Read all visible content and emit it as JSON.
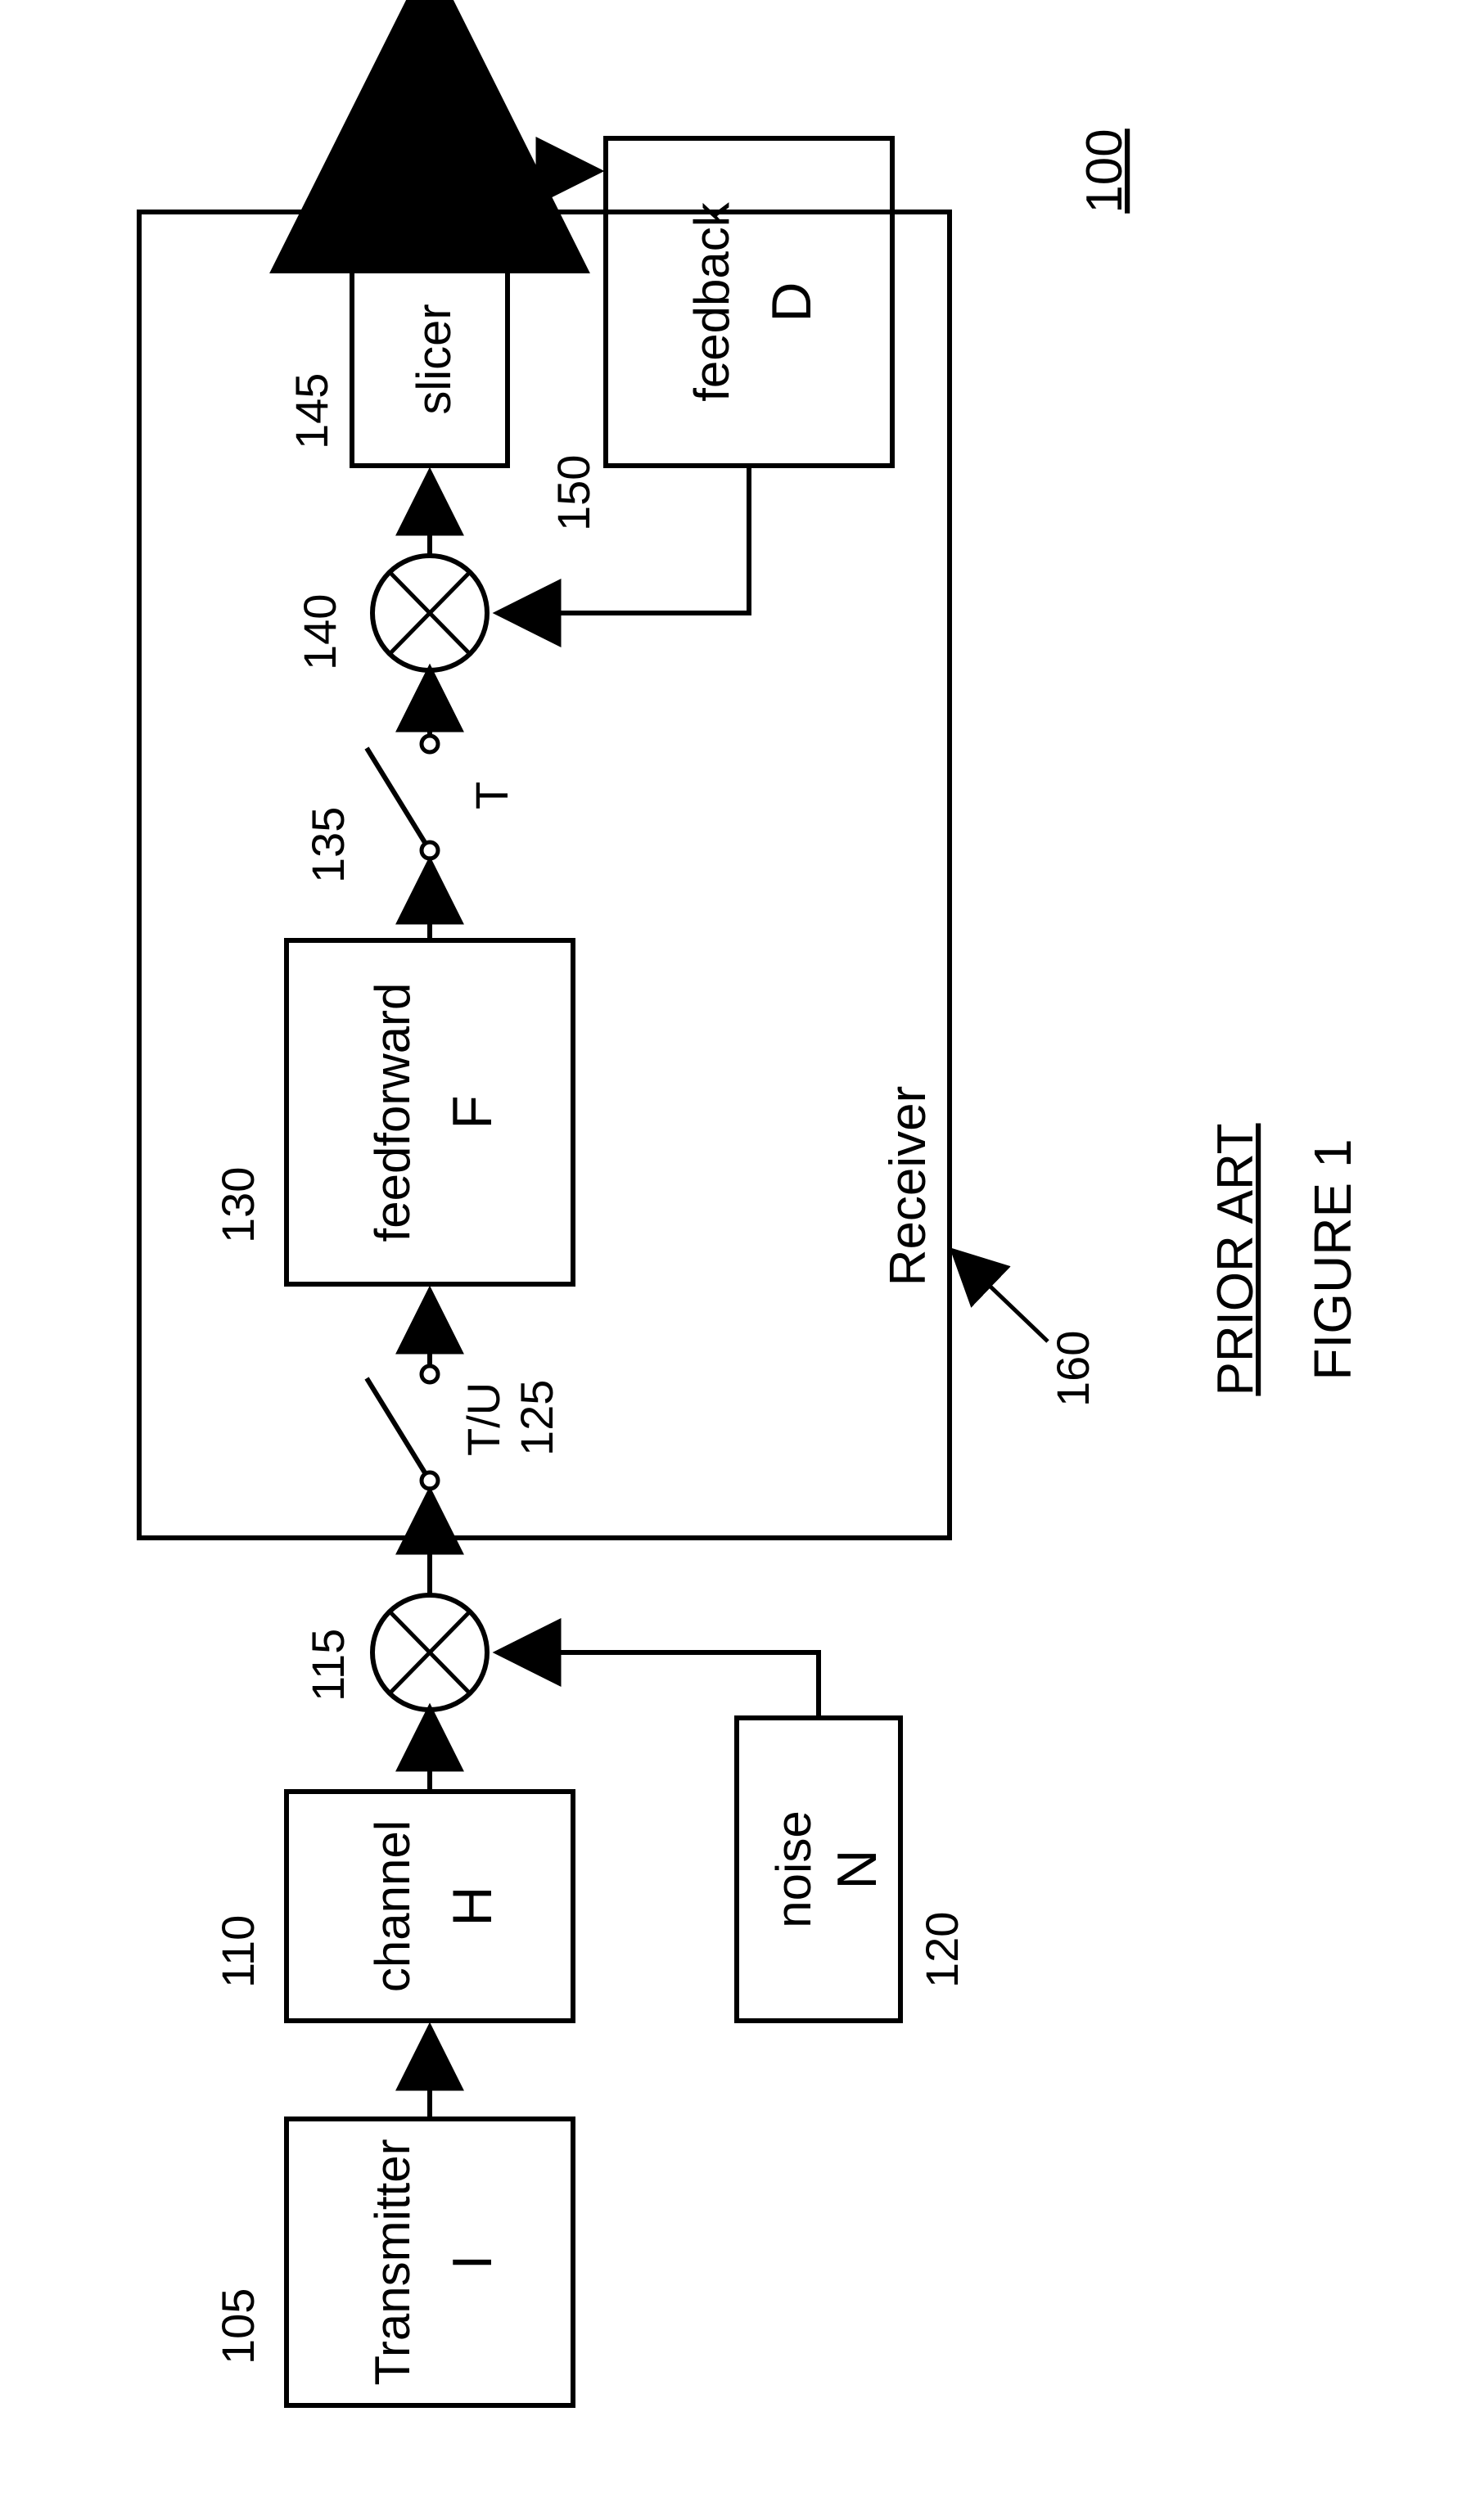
{
  "diagram": {
    "id": "100",
    "caption1": "PRIOR ART",
    "caption2": "FIGURE 1",
    "blocks": {
      "transmitter": {
        "ref": "105",
        "line1": "Transmitter",
        "line2": "I"
      },
      "channel": {
        "ref": "110",
        "line1": "channel",
        "line2": "H"
      },
      "noise": {
        "ref": "120",
        "line1": "noise",
        "line2": "N"
      },
      "sum1": {
        "ref": "115"
      },
      "switch1": {
        "ref": "125",
        "label": "T/U"
      },
      "ff": {
        "ref": "130",
        "line1": "feedforward",
        "line2": "F"
      },
      "switch2": {
        "ref": "135",
        "label": "T"
      },
      "sum2": {
        "ref": "140"
      },
      "slicer": {
        "ref": "145",
        "line1": "slicer"
      },
      "fb": {
        "ref": "150",
        "line1": "feedback",
        "line2": "D"
      },
      "receiver": {
        "ref": "160",
        "label": "Receiver"
      }
    }
  }
}
